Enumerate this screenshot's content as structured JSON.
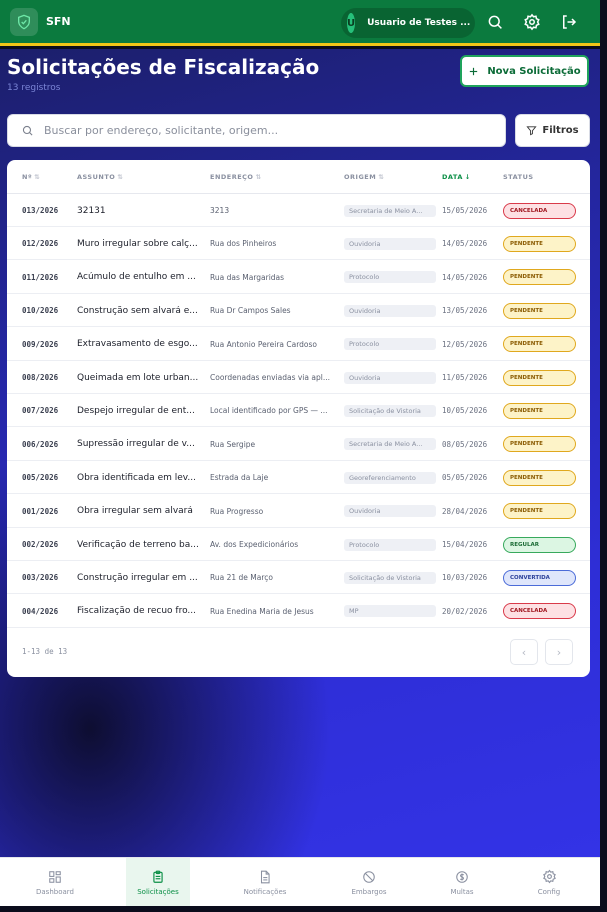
{
  "app": {
    "name": "SFN"
  },
  "user": {
    "initial": "U",
    "name": "Usuario de Testes ..."
  },
  "colors": {
    "primary": "#0b7a3e",
    "accent": "#f2c617",
    "background": "#2e2ed6"
  },
  "page": {
    "title": "Solicitações de Fiscalização",
    "count": "13 registros"
  },
  "actions": {
    "new_label": "Nova Solicitação",
    "filter_label": "Filtros"
  },
  "search": {
    "placeholder": "Buscar por endereço, solicitante, origem..."
  },
  "table": {
    "columns": [
      "Nº",
      "ASSUNTO",
      "ENDEREÇO",
      "ORIGEM",
      "DATA",
      "STATUS"
    ],
    "sorted_column": "DATA",
    "rows": [
      {
        "num": "013/2026",
        "subject": "32131",
        "address": "3213",
        "origin": "Secretaria de Meio A...",
        "date": "15/05/2026",
        "status": "CANCELADA",
        "kind": "cancelada"
      },
      {
        "num": "012/2026",
        "subject": "Muro irregular sobre calç...",
        "address": "Rua dos Pinheiros",
        "origin": "Ouvidoria",
        "date": "14/05/2026",
        "status": "PENDENTE",
        "kind": "pendente"
      },
      {
        "num": "011/2026",
        "subject": "Acúmulo de entulho em ...",
        "address": "Rua das Margaridas",
        "origin": "Protocolo",
        "date": "14/05/2026",
        "status": "PENDENTE",
        "kind": "pendente"
      },
      {
        "num": "010/2026",
        "subject": "Construção sem alvará e...",
        "address": "Rua Dr Campos Sales",
        "origin": "Ouvidoria",
        "date": "13/05/2026",
        "status": "PENDENTE",
        "kind": "pendente"
      },
      {
        "num": "009/2026",
        "subject": "Extravasamento de esgo...",
        "address": "Rua Antonio Pereira Cardoso",
        "origin": "Protocolo",
        "date": "12/05/2026",
        "status": "PENDENTE",
        "kind": "pendente"
      },
      {
        "num": "008/2026",
        "subject": "Queimada em lote urban...",
        "address": "Coordenadas enviadas via apl...",
        "origin": "Ouvidoria",
        "date": "11/05/2026",
        "status": "PENDENTE",
        "kind": "pendente"
      },
      {
        "num": "007/2026",
        "subject": "Despejo irregular de ent...",
        "address": "Local identificado por GPS — ...",
        "origin": "Solicitação de Vistoria",
        "date": "10/05/2026",
        "status": "PENDENTE",
        "kind": "pendente"
      },
      {
        "num": "006/2026",
        "subject": "Supressão irregular de v...",
        "address": "Rua Sergipe",
        "origin": "Secretaria de Meio A...",
        "date": "08/05/2026",
        "status": "PENDENTE",
        "kind": "pendente"
      },
      {
        "num": "005/2026",
        "subject": "Obra identificada em lev...",
        "address": "Estrada da Laje",
        "origin": "Georeferenciamento",
        "date": "05/05/2026",
        "status": "PENDENTE",
        "kind": "pendente"
      },
      {
        "num": "001/2026",
        "subject": "Obra irregular sem alvará",
        "address": "Rua Progresso",
        "origin": "Ouvidoria",
        "date": "28/04/2026",
        "status": "PENDENTE",
        "kind": "pendente"
      },
      {
        "num": "002/2026",
        "subject": "Verificação de terreno ba...",
        "address": "Av. dos Expedicionários",
        "origin": "Protocolo",
        "date": "15/04/2026",
        "status": "REGULAR",
        "kind": "regular"
      },
      {
        "num": "003/2026",
        "subject": "Construção irregular em ...",
        "address": "Rua 21 de Março",
        "origin": "Solicitação de Vistoria",
        "date": "10/03/2026",
        "status": "CONVERTIDA",
        "kind": "convertida"
      },
      {
        "num": "004/2026",
        "subject": "Fiscalização de recuo fro...",
        "address": "Rua Enedina Maria de Jesus",
        "origin": "MP",
        "date": "20/02/2026",
        "status": "CANCELADA",
        "kind": "cancelada"
      }
    ]
  },
  "pagination": {
    "text": "1-13 de 13"
  },
  "nav": [
    {
      "label": "Dashboard",
      "icon": "grid-icon"
    },
    {
      "label": "Solicitações",
      "icon": "clipboard-icon"
    },
    {
      "label": "Notificações",
      "icon": "document-icon"
    },
    {
      "label": "Embargos",
      "icon": "ban-icon"
    },
    {
      "label": "Multas",
      "icon": "dollar-icon"
    },
    {
      "label": "Config",
      "icon": "gear-icon"
    }
  ],
  "active_nav": "Solicitações"
}
